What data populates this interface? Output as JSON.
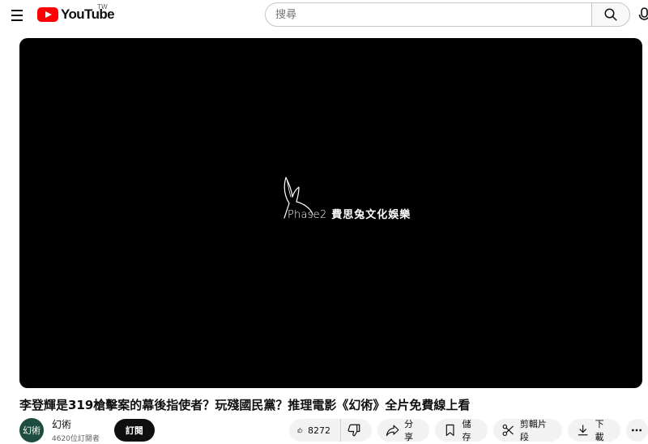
{
  "masthead": {
    "logo_text": "YouTube",
    "region_code": "TW",
    "search_placeholder": "搜尋"
  },
  "player": {
    "brand_en": "Phase2",
    "brand_zh": "費思兔文化娛樂"
  },
  "video": {
    "title": "李登輝是319槍擊案的幕後指使者？玩殘國民黨？推理電影《幻術》全片免費線上看"
  },
  "owner": {
    "avatar_text": "幻術",
    "channel_name": "幻術",
    "subscribers": "4620位訂閱者",
    "subscribe_label": "訂閱"
  },
  "actions": {
    "like_count": "8272",
    "share_label": "分享",
    "save_label": "儲存",
    "clip_label": "剪輯片段",
    "download_label": "下載"
  },
  "colors": {
    "brand_red": "#ff0000",
    "avatar_bg": "#1e4d40",
    "pill_bg": "#f2f2f2"
  }
}
